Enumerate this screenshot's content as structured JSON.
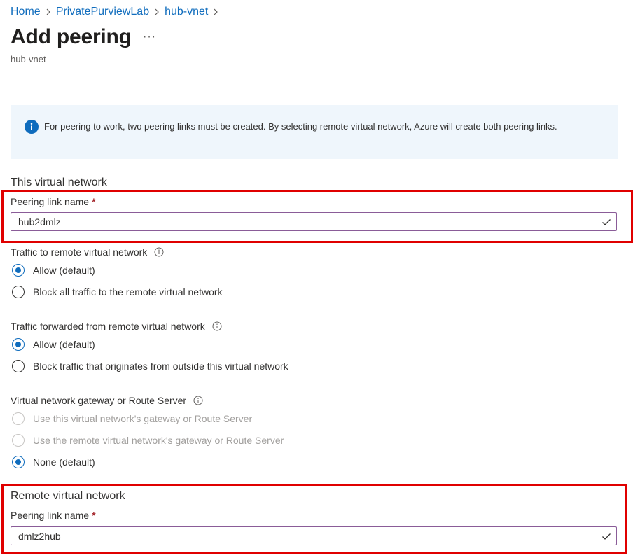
{
  "breadcrumb": [
    {
      "label": "Home"
    },
    {
      "label": "PrivatePurviewLab"
    },
    {
      "label": "hub-vnet"
    }
  ],
  "page": {
    "title": "Add peering",
    "more": "···",
    "subtitle": "hub-vnet"
  },
  "info": {
    "text": "For peering to work, two peering links must be created. By selecting remote virtual network, Azure will create both peering links."
  },
  "this_vnet": {
    "section_title": "This virtual network",
    "peering_label": "Peering link name",
    "required_mark": "*",
    "peering_value": "hub2dmlz"
  },
  "traffic_to_remote": {
    "label": "Traffic to remote virtual network",
    "options": [
      "Allow (default)",
      "Block all traffic to the remote virtual network"
    ],
    "selected": 0
  },
  "traffic_forwarded": {
    "label": "Traffic forwarded from remote virtual network",
    "options": [
      "Allow (default)",
      "Block traffic that originates from outside this virtual network"
    ],
    "selected": 0
  },
  "gateway": {
    "label": "Virtual network gateway or Route Server",
    "options": [
      "Use this virtual network's gateway or Route Server",
      "Use the remote virtual network's gateway or Route Server",
      "None (default)"
    ],
    "selected": 2
  },
  "remote_vnet": {
    "section_title": "Remote virtual network",
    "peering_label": "Peering link name",
    "required_mark": "*",
    "peering_value": "dmlz2hub"
  },
  "colors": {
    "link": "#0f6cbd",
    "highlight": "#e00000",
    "info_bg": "#eff6fc",
    "input_border": "#8a5c98"
  }
}
